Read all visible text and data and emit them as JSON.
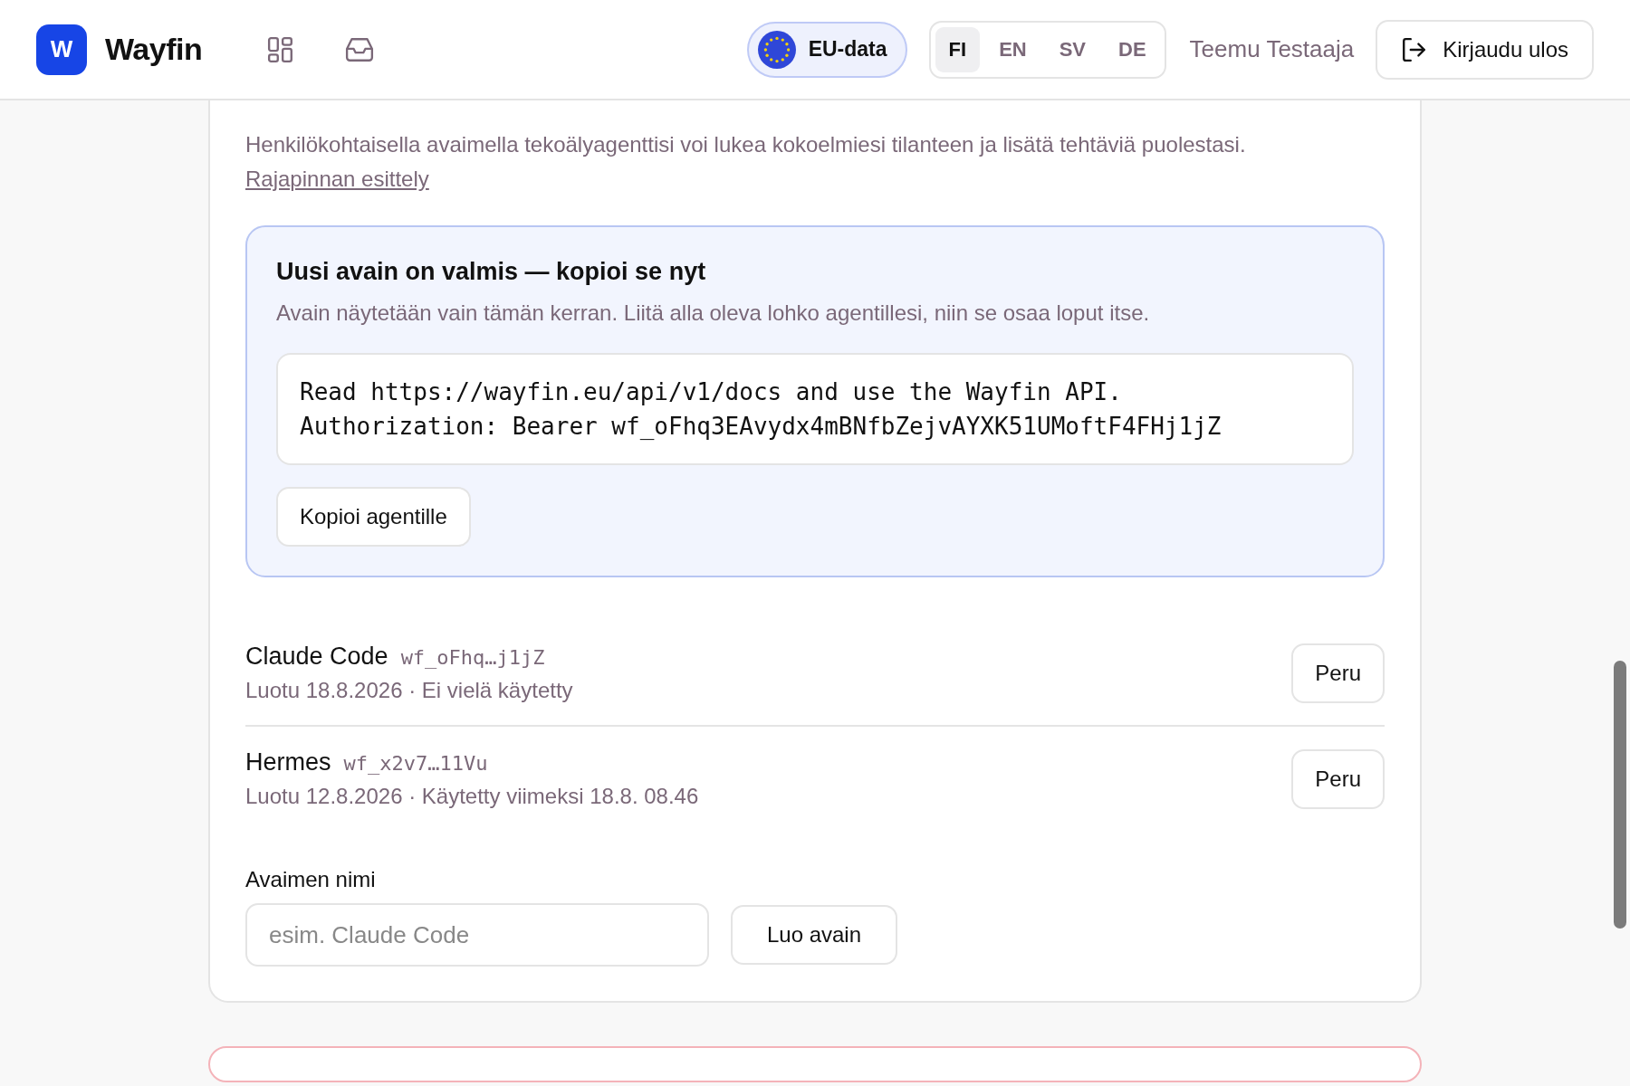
{
  "header": {
    "logo_letter": "W",
    "brand": "Wayfin",
    "eu_badge": "EU-data",
    "languages": [
      {
        "label": "FI",
        "selected": true
      },
      {
        "label": "EN",
        "selected": false
      },
      {
        "label": "SV",
        "selected": false
      },
      {
        "label": "DE",
        "selected": false
      }
    ],
    "user": "Teemu Testaaja",
    "logout": "Kirjaudu ulos"
  },
  "intro": {
    "text": "Henkilökohtaisella avaimella tekoälyagenttisi voi lukea kokoelmiesi tilanteen ja lisätä tehtäviä puolestasi.",
    "link": "Rajapinnan esittely"
  },
  "new_key": {
    "title": "Uusi avain on valmis — kopioi se nyt",
    "hint": "Avain näytetään vain tämän kerran. Liitä alla oleva lohko agentillesi, niin se osaa loput itse.",
    "code_lines": [
      "Read https://wayfin.eu/api/v1/docs and use the Wayfin API.",
      "Authorization: Bearer wf_oFhq3EAvydx4mBNfbZejvAYXK51UMoftF4FHj1jZ"
    ],
    "copy_button": "Kopioi agentille"
  },
  "keys": [
    {
      "name": "Claude Code",
      "prefix": "wf_oFhq…j1jZ",
      "meta": "Luotu 18.8.2026 · Ei vielä käytetty",
      "button": "Peru"
    },
    {
      "name": "Hermes",
      "prefix": "wf_x2v7…11Vu",
      "meta": "Luotu 12.8.2026 · Käytetty viimeksi 18.8. 08.46",
      "button": "Peru"
    }
  ],
  "create": {
    "label": "Avaimen nimi",
    "placeholder": "esim. Claude Code",
    "button": "Luo avain"
  }
}
